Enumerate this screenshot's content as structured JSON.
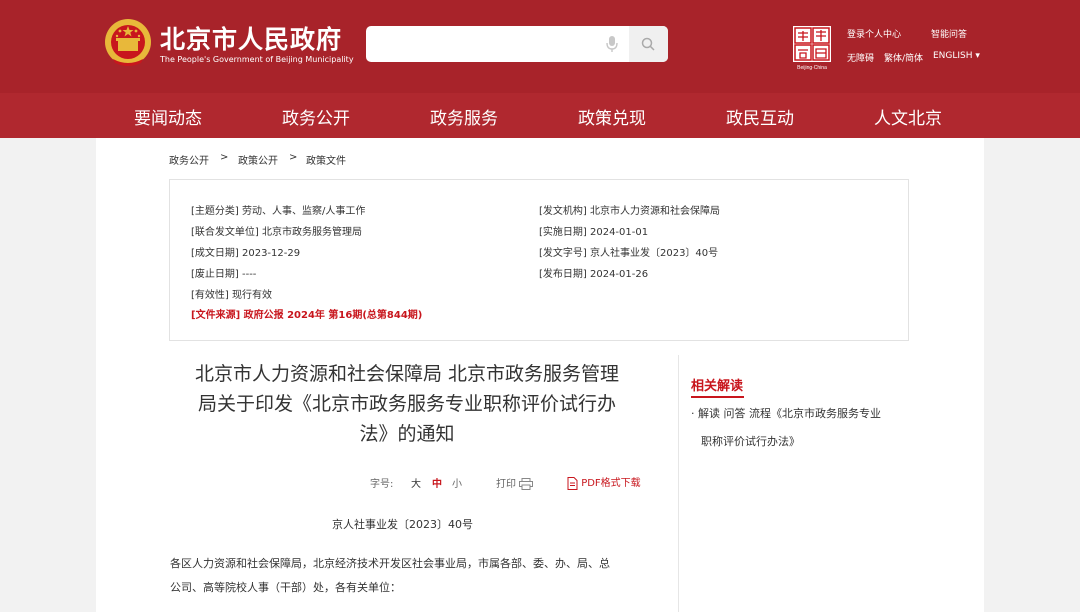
{
  "header": {
    "site_name": "北京市人民政府",
    "site_name_en": "The People's Government of Beijing Municipality",
    "search_placeholder": "",
    "links": {
      "login": "登录个人中心",
      "smart_qa": "智能问答",
      "accessibility": "无障碍",
      "trad_simp": "繁体/简体",
      "english": "ENGLISH",
      "english_arrow": "▾"
    },
    "capital_logo_text": "Beijing·China"
  },
  "nav": {
    "items": [
      "要闻动态",
      "政务公开",
      "政务服务",
      "政策兑现",
      "政民互动",
      "人文北京"
    ]
  },
  "breadcrumb": {
    "items": [
      "政务公开",
      "政策公开",
      "政策文件"
    ],
    "separator": ">"
  },
  "meta": {
    "left": [
      "[主题分类] 劳动、人事、监察/人事工作",
      "[联合发文单位] 北京市政务服务管理局",
      "[成文日期] 2023-12-29",
      "[废止日期] ----",
      "[有效性] 现行有效"
    ],
    "source": "[文件来源] 政府公报 2024年 第16期(总第844期)",
    "right": [
      "[发文机构] 北京市人力资源和社会保障局",
      "[实施日期] 2024-01-01",
      "[发文字号] 京人社事业发〔2023〕40号",
      "[发布日期] 2024-01-26"
    ]
  },
  "article": {
    "title_lines": [
      "北京市人力资源和社会保障局 北京市政务服务管理",
      "局关于印发《北京市政务服务专业职称评价试行办",
      "法》的通知"
    ],
    "tools": {
      "font_size_label": "字号:",
      "large": "大",
      "medium": "中",
      "small": "小",
      "print": "打印",
      "pdf": "PDF格式下载"
    },
    "doc_number": "京人社事业发〔2023〕40号",
    "body_lines": [
      "各区人力资源和社会保障局，北京经济技术开发区社会事业局，市属各部、委、办、局、总",
      "公司、高等院校人事（干部）处，各有关单位："
    ]
  },
  "related": {
    "title": "相关解读",
    "lines": [
      "· 解读  问答  流程《北京市政务服务专业",
      "职称评价试行办法》"
    ]
  },
  "colors": {
    "header_red": "#a8232a",
    "nav_red": "#b0282f",
    "accent_red": "#c8161d"
  }
}
